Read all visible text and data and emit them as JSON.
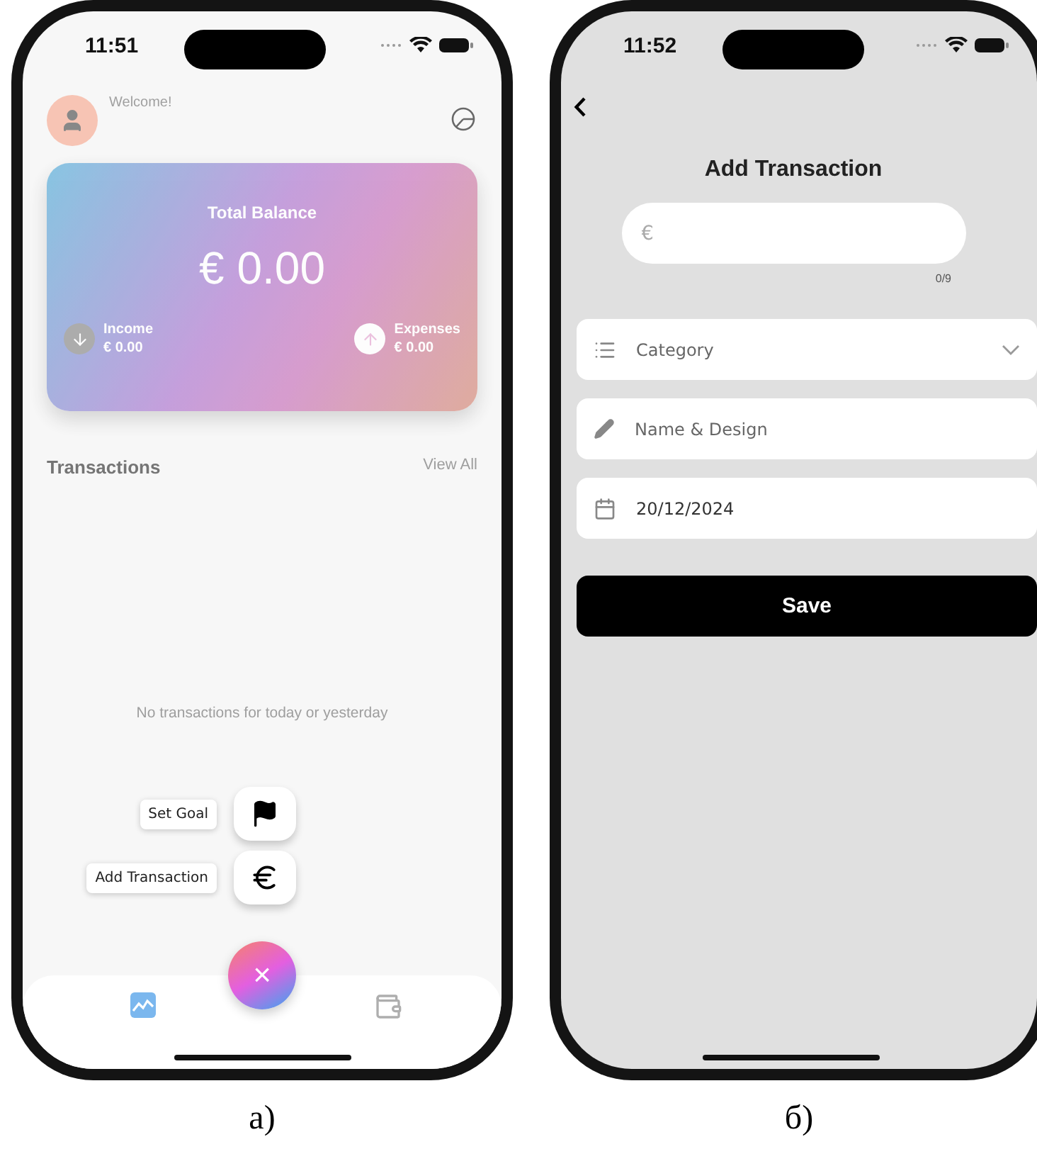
{
  "screen_a": {
    "caption": "a)",
    "status_bar": {
      "time": "11:51"
    },
    "menu_open": true,
    "header": {
      "greeting": "Welcome!"
    },
    "balance_card": {
      "title": "Total Balance",
      "amount": "€ 0.00",
      "income": {
        "label": "Income",
        "amount": "€ 0.00"
      },
      "expenses": {
        "label": "Expenses",
        "amount": "€ 0.00"
      }
    },
    "transactions": {
      "title": "Transactions",
      "link": "View All",
      "empty_message": "No transactions for today or yesterday"
    },
    "speed_dial": [
      {
        "label": "Set Goal"
      },
      {
        "label": "Add Transaction"
      }
    ],
    "fab": {
      "symbol": "×"
    },
    "bottom_nav": [
      {
        "selected": true
      },
      {
        "selected": false
      }
    ]
  },
  "screen_b": {
    "caption": "б)",
    "status_bar": {
      "time": "11:52"
    },
    "title": "Add Transaction",
    "amount_field": {
      "placeholder": "€",
      "counter": "0/9"
    },
    "fields": [
      {
        "kind": "dropdown",
        "placeholder": "Category"
      },
      {
        "kind": "text",
        "placeholder": "Name & Design"
      },
      {
        "kind": "date",
        "value": "20/12/2024"
      }
    ],
    "save_button": "Save"
  }
}
